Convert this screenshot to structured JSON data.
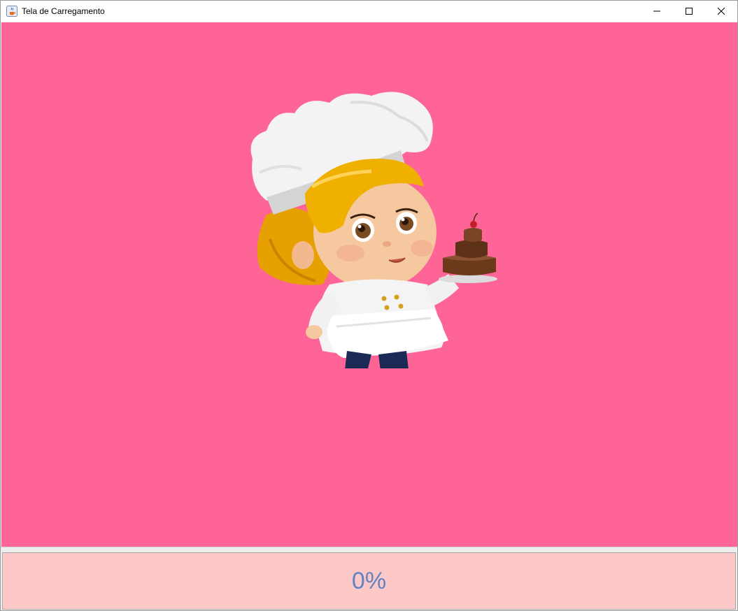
{
  "window": {
    "title": "Tela de Carregamento",
    "icon": "java-coffee-icon",
    "controls": [
      "minimize-icon",
      "maximize-icon",
      "close-icon"
    ]
  },
  "content": {
    "background_color": "#ff6496",
    "illustration": "chef-girl-holding-cake"
  },
  "progress": {
    "percent": 0,
    "label": "0%",
    "track_color": "#fcc8c8",
    "text_color": "#6382bf"
  }
}
